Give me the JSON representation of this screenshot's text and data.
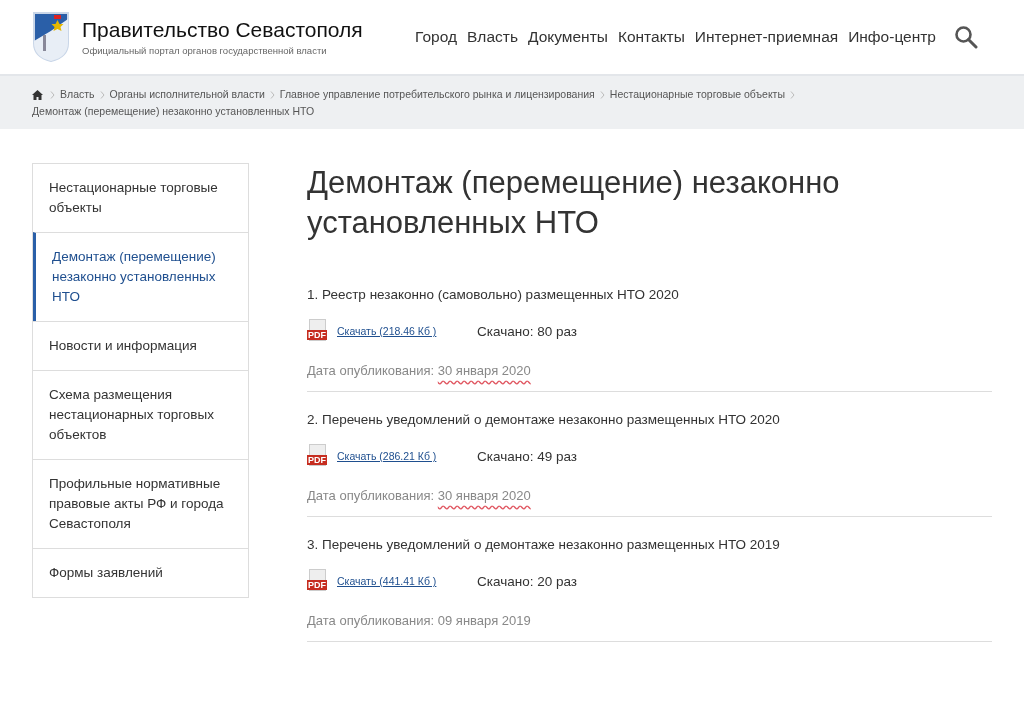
{
  "header": {
    "title": "Правительство Севастополя",
    "subtitle": "Официальный портал органов государственной власти",
    "nav": [
      {
        "label": "Город"
      },
      {
        "label": "Власть"
      },
      {
        "label": "Документы"
      },
      {
        "label": "Контакты"
      },
      {
        "label": "Интернет-приемная"
      },
      {
        "label": "Инфо-центр"
      }
    ]
  },
  "breadcrumbs": [
    "Власть",
    "Органы исполнительной власти",
    "Главное управление потребительского рынка и лицензирования",
    "Нестационарные торговые объекты",
    "Демонтаж (перемещение) незаконно установленных НТО"
  ],
  "sidebar": {
    "items": [
      {
        "label": "Нестационарные торговые объекты",
        "selected": false
      },
      {
        "label": "Демонтаж (перемещение) незаконно установленных НТО",
        "selected": true
      },
      {
        "label": "Новости и информация",
        "selected": false
      },
      {
        "label": "Схема размещения нестационарных торговых объектов",
        "selected": false
      },
      {
        "label": "Профильные нормативные правовые акты РФ и города Севастополя",
        "selected": false
      },
      {
        "label": "Формы заявлений",
        "selected": false
      }
    ]
  },
  "page_title": "Демонтаж (перемещение) незаконно установленных НТО",
  "documents": [
    {
      "title": "1. Реестр незаконно (самовольно) размещенных НТО 2020",
      "file_type": "PDF",
      "link": "Скачать (218.46 Кб )",
      "downloads": "Скачано: 80 раз",
      "date_label": "Дата опубликования:",
      "date": "30 января 2020",
      "date_underlined": true
    },
    {
      "title": "2. Перечень уведомлений о демонтаже незаконно размещенных НТО 2020",
      "file_type": "PDF",
      "link": "Скачать (286.21 Кб )",
      "downloads": "Скачано: 49 раз",
      "date_label": "Дата опубликования:",
      "date": "30 января 2020",
      "date_underlined": true
    },
    {
      "title": "3. Перечень уведомлений о демонтаже незаконно размещенных НТО 2019",
      "file_type": "PDF",
      "link": "Скачать (441.41 Кб )",
      "downloads": "Скачано: 20 раз",
      "date_label": "Дата опубликования:",
      "date": "09 января 2019",
      "date_underlined": false
    }
  ]
}
